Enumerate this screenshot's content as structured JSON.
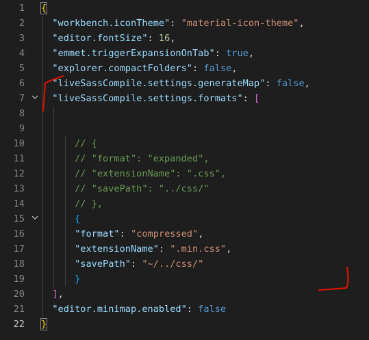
{
  "editor": {
    "lines": [
      {
        "num": "1",
        "tokens": [
          {
            "t": "{",
            "c": "br1"
          }
        ]
      },
      {
        "num": "2",
        "tokens": [
          {
            "t": "  "
          },
          {
            "t": "\"workbench.iconTheme\"",
            "c": "k"
          },
          {
            "t": ": ",
            "c": "p"
          },
          {
            "t": "\"material-icon-theme\"",
            "c": "s"
          },
          {
            "t": ",",
            "c": "p"
          }
        ]
      },
      {
        "num": "3",
        "tokens": [
          {
            "t": "  "
          },
          {
            "t": "\"editor.fontSize\"",
            "c": "k"
          },
          {
            "t": ": ",
            "c": "p"
          },
          {
            "t": "16",
            "c": "n"
          },
          {
            "t": ",",
            "c": "p"
          }
        ]
      },
      {
        "num": "4",
        "tokens": [
          {
            "t": "  "
          },
          {
            "t": "\"emmet.triggerExpansionOnTab\"",
            "c": "k"
          },
          {
            "t": ": ",
            "c": "p"
          },
          {
            "t": "true",
            "c": "b"
          },
          {
            "t": ",",
            "c": "p"
          }
        ]
      },
      {
        "num": "5",
        "tokens": [
          {
            "t": "  "
          },
          {
            "t": "\"explorer.compactFolders\"",
            "c": "k"
          },
          {
            "t": ": ",
            "c": "p"
          },
          {
            "t": "false",
            "c": "b"
          },
          {
            "t": ",",
            "c": "p"
          }
        ]
      },
      {
        "num": "6",
        "tokens": [
          {
            "t": "  "
          },
          {
            "t": "\"liveSassCompile.settings.generateMap\"",
            "c": "k"
          },
          {
            "t": ": ",
            "c": "p"
          },
          {
            "t": "false",
            "c": "b"
          },
          {
            "t": ",",
            "c": "p"
          }
        ]
      },
      {
        "num": "7",
        "fold": true,
        "tokens": [
          {
            "t": "  "
          },
          {
            "t": "\"liveSassCompile.settings.formats\"",
            "c": "k"
          },
          {
            "t": ": ",
            "c": "p"
          },
          {
            "t": "[",
            "c": "br2"
          }
        ]
      },
      {
        "num": "8",
        "tokens": []
      },
      {
        "num": "9",
        "tokens": []
      },
      {
        "num": "10",
        "tokens": [
          {
            "t": "      "
          },
          {
            "t": "// {",
            "c": "c"
          }
        ]
      },
      {
        "num": "11",
        "tokens": [
          {
            "t": "      "
          },
          {
            "t": "// \"format\": \"expanded\",",
            "c": "c"
          }
        ]
      },
      {
        "num": "12",
        "tokens": [
          {
            "t": "      "
          },
          {
            "t": "// \"extensionName\": \".css\",",
            "c": "c"
          }
        ]
      },
      {
        "num": "13",
        "tokens": [
          {
            "t": "      "
          },
          {
            "t": "// \"savePath\": \"../css/\"",
            "c": "c"
          }
        ]
      },
      {
        "num": "14",
        "tokens": [
          {
            "t": "      "
          },
          {
            "t": "// },",
            "c": "c"
          }
        ]
      },
      {
        "num": "15",
        "fold": true,
        "tokens": [
          {
            "t": "      "
          },
          {
            "t": "{",
            "c": "br3"
          }
        ]
      },
      {
        "num": "16",
        "tokens": [
          {
            "t": "      "
          },
          {
            "t": "\"format\"",
            "c": "k"
          },
          {
            "t": ": ",
            "c": "p"
          },
          {
            "t": "\"compressed\"",
            "c": "s"
          },
          {
            "t": ",",
            "c": "p"
          }
        ]
      },
      {
        "num": "17",
        "tokens": [
          {
            "t": "      "
          },
          {
            "t": "\"extensionName\"",
            "c": "k"
          },
          {
            "t": ": ",
            "c": "p"
          },
          {
            "t": "\".min.css\"",
            "c": "s"
          },
          {
            "t": ",",
            "c": "p"
          }
        ]
      },
      {
        "num": "18",
        "tokens": [
          {
            "t": "      "
          },
          {
            "t": "\"savePath\"",
            "c": "k"
          },
          {
            "t": ": ",
            "c": "p"
          },
          {
            "t": "\"~/../css/\"",
            "c": "s"
          }
        ]
      },
      {
        "num": "19",
        "tokens": [
          {
            "t": "      "
          },
          {
            "t": "}",
            "c": "br3"
          }
        ]
      },
      {
        "num": "20",
        "tokens": [
          {
            "t": "  "
          },
          {
            "t": "]",
            "c": "br2"
          },
          {
            "t": ",",
            "c": "p"
          }
        ]
      },
      {
        "num": "21",
        "tokens": [
          {
            "t": "  "
          },
          {
            "t": "\"editor.minimap.enabled\"",
            "c": "k"
          },
          {
            "t": ": ",
            "c": "p"
          },
          {
            "t": "false",
            "c": "b"
          }
        ]
      },
      {
        "num": "22",
        "active": true,
        "tokens": [
          {
            "t": "}",
            "c": "br1"
          }
        ]
      }
    ]
  },
  "colors": {
    "background": "#1e1e1e",
    "key": "#9cdcfe",
    "string": "#ce9178",
    "number": "#b5cea8",
    "boolean": "#569cd6",
    "comment": "#6a9955",
    "annotation": "#e51400"
  },
  "icons": {
    "fold": "chevron-down-icon"
  }
}
